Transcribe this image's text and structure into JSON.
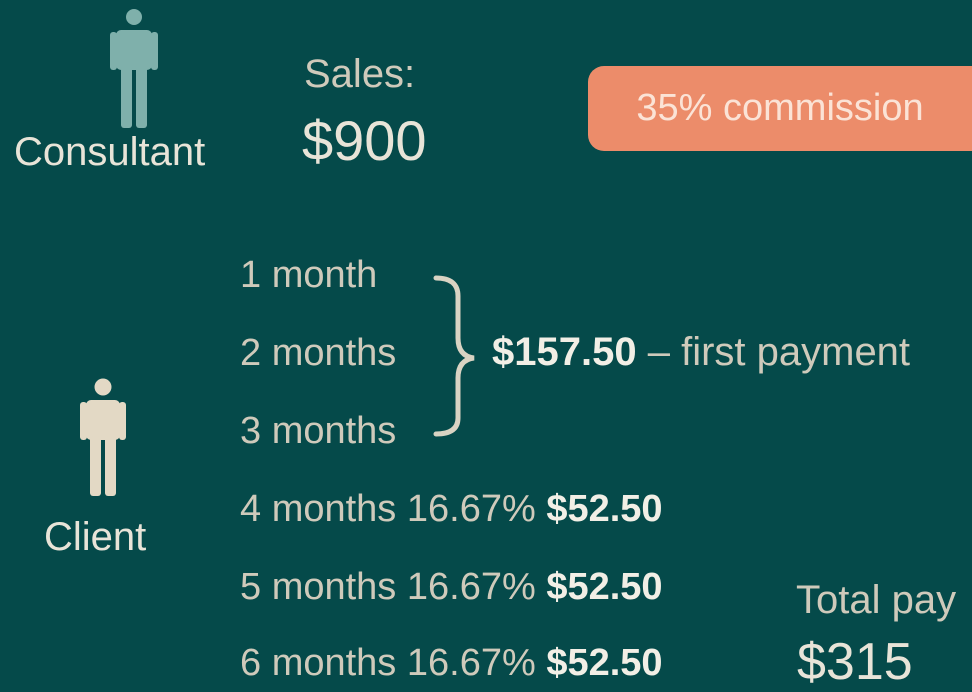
{
  "consultant": {
    "label": "Consultant",
    "icon": "person-icon",
    "icon_color": "#7fb0ab"
  },
  "client": {
    "label": "Client",
    "icon": "person-icon",
    "icon_color": "#e3d9c5"
  },
  "sales": {
    "label": "Sales:",
    "value": "$900"
  },
  "commission_badge": {
    "text": "35% commission",
    "color": "#ec8c6a"
  },
  "schedule": {
    "grouped_months": [
      "1 month",
      "2 months",
      "3 months"
    ],
    "first_payment": {
      "amount": "$157.50",
      "text": "– first payment"
    },
    "installments": [
      {
        "month": "4 months",
        "percent": "16.67%",
        "amount": "$52.50"
      },
      {
        "month": "5 months",
        "percent": "16.67%",
        "amount": "$52.50"
      },
      {
        "month": "6 months",
        "percent": "16.67%",
        "amount": "$52.50"
      }
    ]
  },
  "total": {
    "label": "Total pay",
    "value": "$315"
  }
}
